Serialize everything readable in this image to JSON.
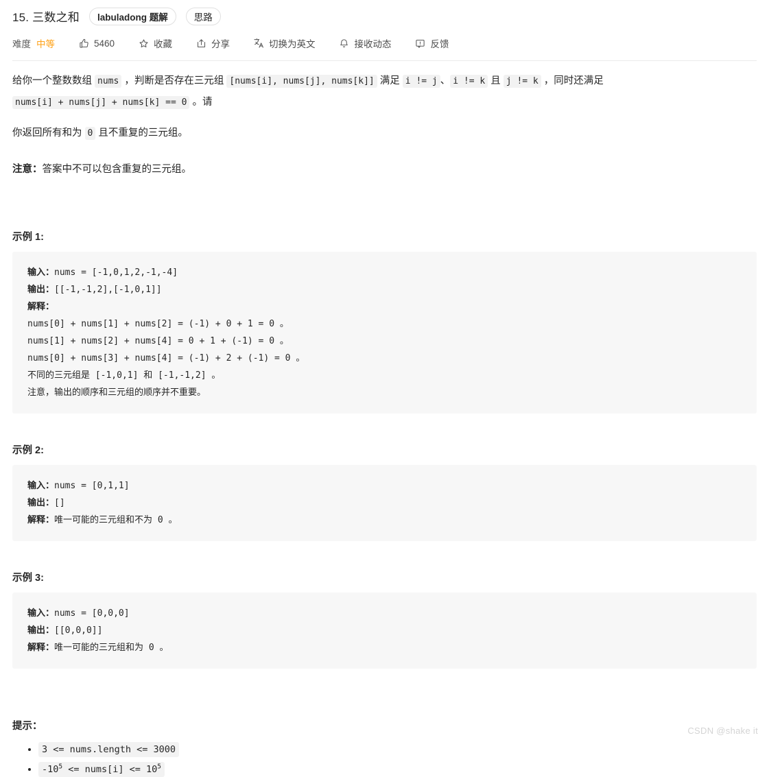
{
  "header": {
    "title": "15. 三数之和",
    "tags": [
      {
        "label": "labuladong 题解",
        "bold": true
      },
      {
        "label": "思路",
        "bold": false
      }
    ]
  },
  "toolbar": {
    "difficulty_label": "难度",
    "difficulty_value": "中等",
    "difficulty_color": "#ffa116",
    "items": [
      {
        "icon": "thumbs-up-icon",
        "label": "5460"
      },
      {
        "icon": "star-icon",
        "label": "收藏"
      },
      {
        "icon": "share-icon",
        "label": "分享"
      },
      {
        "icon": "translate-icon",
        "label": "切换为英文"
      },
      {
        "icon": "bell-icon",
        "label": "接收动态"
      },
      {
        "icon": "feedback-icon",
        "label": "反馈"
      }
    ]
  },
  "description": {
    "p1": {
      "t1": "给你一个整数数组 ",
      "c1": "nums",
      "t2": " ，判断是否存在三元组 ",
      "c2": "[nums[i], nums[j], nums[k]]",
      "t3": " 满足 ",
      "c3": "i != j",
      "t4": "、",
      "c4": "i != k",
      "t5": " 且 ",
      "c5": "j != k",
      "t6": " ，同时还满足 ",
      "c6": "nums[i] + nums[j] + nums[k] == 0",
      "t7": " 。请"
    },
    "p2": {
      "t1": "你返回所有和为 ",
      "c1": "0",
      "t2": " 且不重复的三元组。"
    },
    "note": {
      "bold": "注意：",
      "text": "答案中不可以包含重复的三元组。"
    }
  },
  "examples": [
    {
      "heading": "示例 1:",
      "lines": [
        {
          "label": "输入：",
          "value": "nums = [-1,0,1,2,-1,-4]"
        },
        {
          "label": "输出：",
          "value": "[[-1,-1,2],[-1,0,1]]"
        },
        {
          "label": "解释：",
          "value": ""
        },
        {
          "label": "",
          "value": "nums[0] + nums[1] + nums[2] = (-1) + 0 + 1 = 0 。"
        },
        {
          "label": "",
          "value": "nums[1] + nums[2] + nums[4] = 0 + 1 + (-1) = 0 。"
        },
        {
          "label": "",
          "value": "nums[0] + nums[3] + nums[4] = (-1) + 2 + (-1) = 0 。"
        },
        {
          "label": "",
          "value": "不同的三元组是 [-1,0,1] 和 [-1,-1,2] 。"
        },
        {
          "label": "",
          "value": "注意，输出的顺序和三元组的顺序并不重要。"
        }
      ]
    },
    {
      "heading": "示例 2:",
      "lines": [
        {
          "label": "输入：",
          "value": "nums = [0,1,1]"
        },
        {
          "label": "输出：",
          "value": "[]"
        },
        {
          "label": "解释：",
          "value": "唯一可能的三元组和不为 0 。"
        }
      ]
    },
    {
      "heading": "示例 3:",
      "lines": [
        {
          "label": "输入：",
          "value": "nums = [0,0,0]"
        },
        {
          "label": "输出：",
          "value": "[[0,0,0]]"
        },
        {
          "label": "解释：",
          "value": "唯一可能的三元组和为 0 。"
        }
      ]
    }
  ],
  "hints": {
    "heading": "提示：",
    "items": [
      {
        "pre": "3 <= nums.length <= 3000",
        "sup": "",
        "post": ""
      },
      {
        "pre": "-10",
        "sup": "5",
        "mid": " <= nums[i] <= 10",
        "sup2": "5",
        "post": ""
      }
    ]
  },
  "watermark": "CSDN @shake it"
}
